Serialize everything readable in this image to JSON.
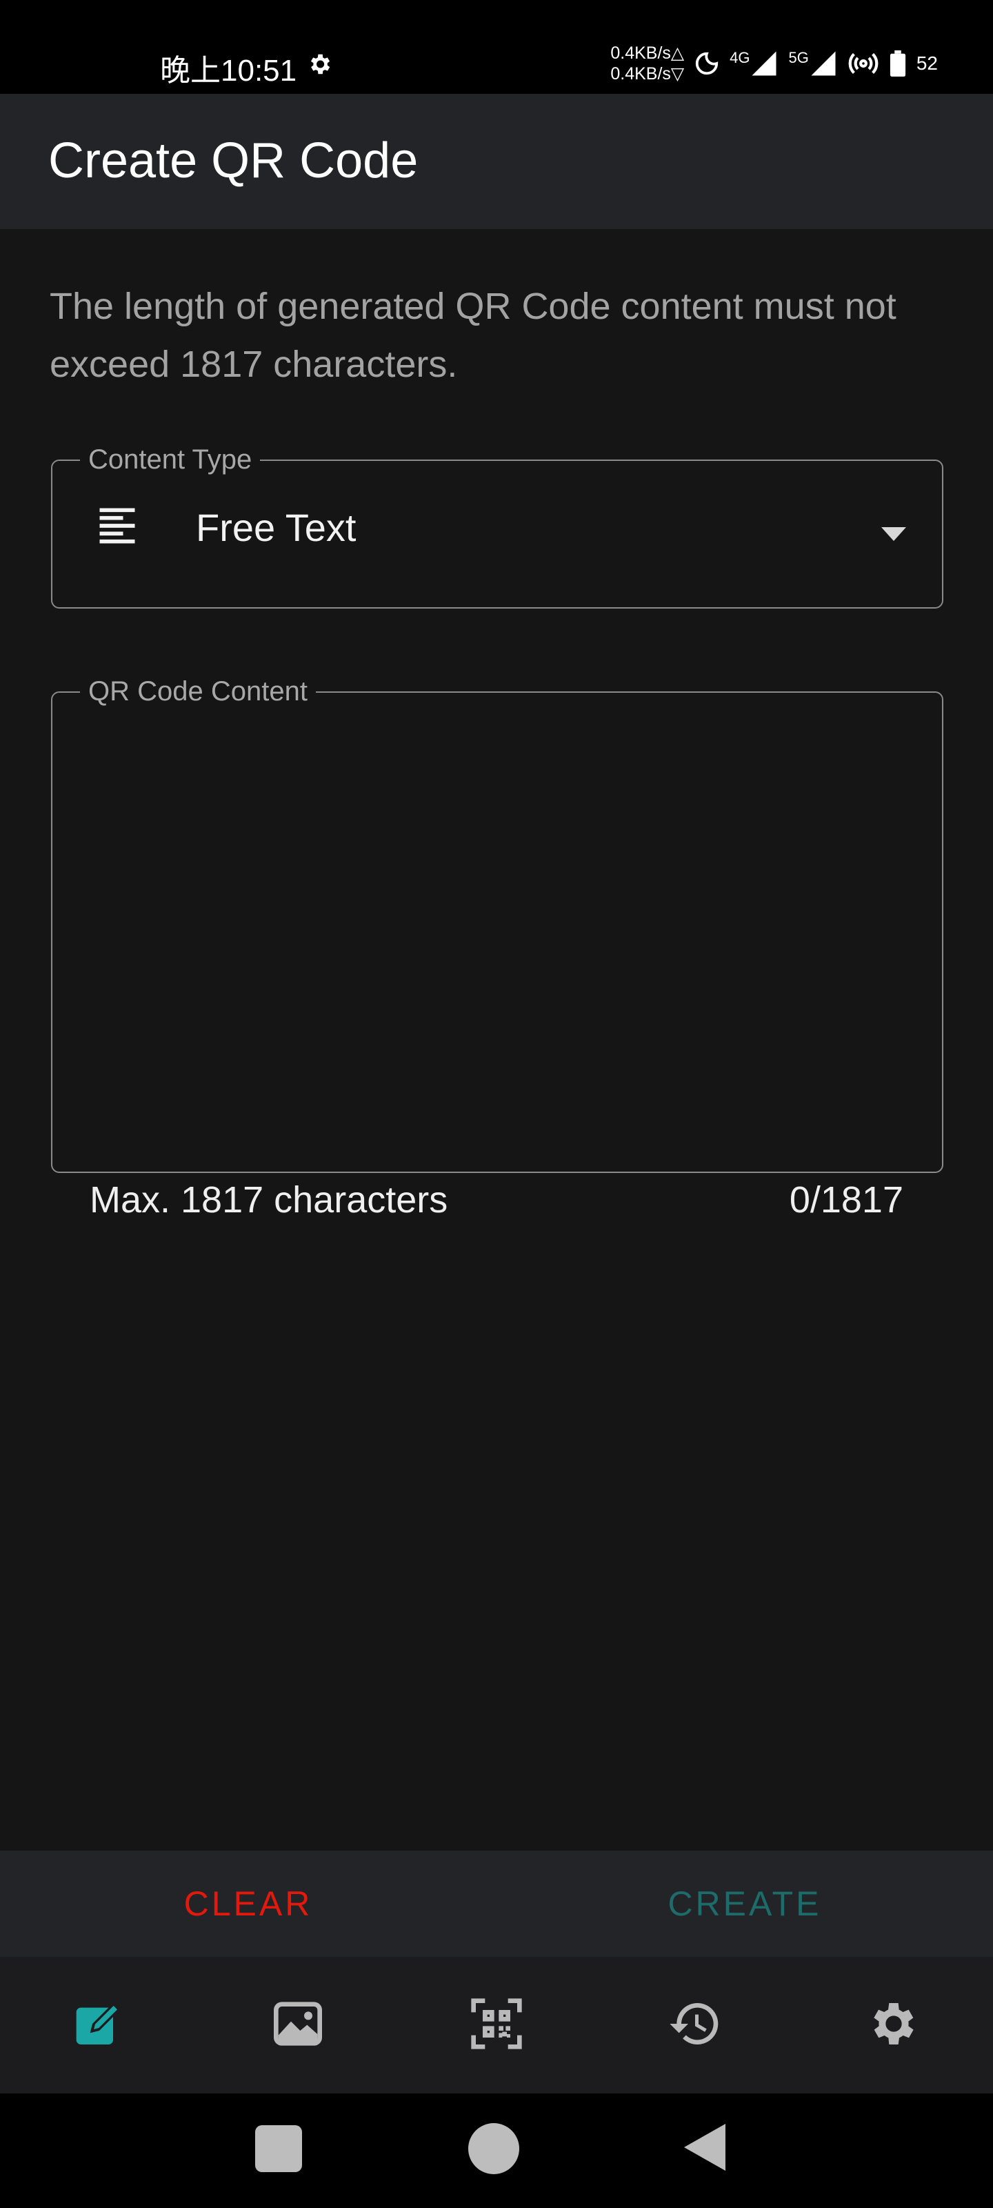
{
  "status_bar": {
    "time": "晚上10:51",
    "net_up": "0.4KB/s△",
    "net_down": "0.4KB/s▽",
    "signal_1": "4G",
    "signal_2": "5G",
    "battery": "52"
  },
  "app_bar": {
    "title": "Create QR Code"
  },
  "hint": " The length of generated QR Code content must not exceed 1817 characters.",
  "content_type": {
    "label": "Content Type",
    "value": "Free Text",
    "icon": "text-align-icon"
  },
  "qr_content": {
    "label": "QR Code Content",
    "value": "",
    "helper": "Max. 1817 characters",
    "counter": "0/1817"
  },
  "actions": {
    "clear_label": "CLEAR",
    "create_label": "CREATE",
    "clear_color": "#e3190e",
    "create_color": "#1d6b6a"
  },
  "bottom_nav": {
    "items": [
      {
        "icon": "edit-icon",
        "active": true
      },
      {
        "icon": "image-icon",
        "active": false
      },
      {
        "icon": "qr-scan-icon",
        "active": false
      },
      {
        "icon": "history-icon",
        "active": false
      },
      {
        "icon": "settings-icon",
        "active": false
      }
    ],
    "active_color": "#1aa7a5"
  }
}
